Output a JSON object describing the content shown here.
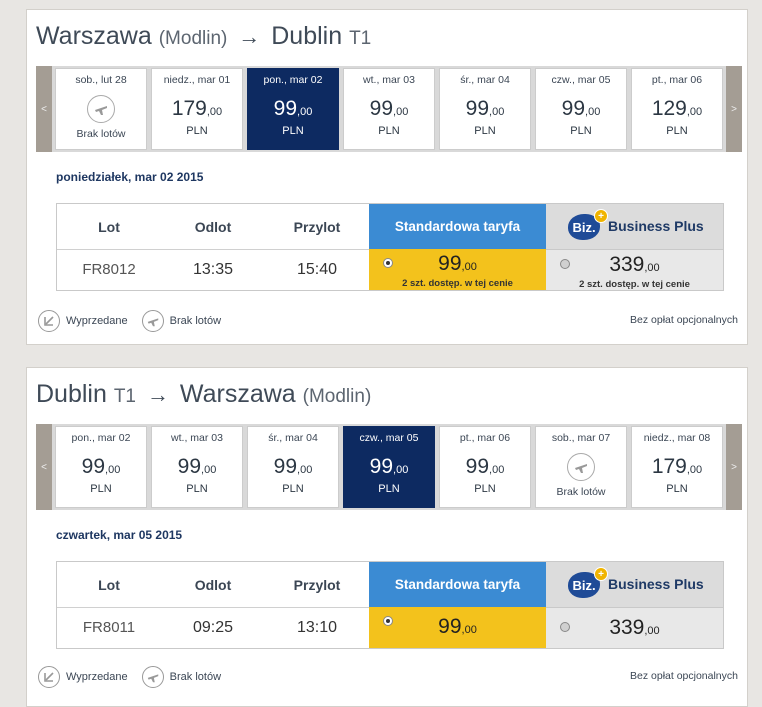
{
  "outbound": {
    "origin": "Warszawa",
    "origin_sub": "(Modlin)",
    "arrow": "→",
    "dest": "Dublin",
    "dest_sub": "T1",
    "nav_prev": "<",
    "nav_next": ">",
    "days": [
      {
        "label": "sob., lut 28",
        "no_flights": true,
        "no_flights_label": "Brak lotów",
        "selected": false
      },
      {
        "label": "niedz., mar 01",
        "price": "179",
        "decimals": ",00",
        "currency": "PLN",
        "selected": false
      },
      {
        "label": "pon., mar 02",
        "price": "99",
        "decimals": ",00",
        "currency": "PLN",
        "selected": true
      },
      {
        "label": "wt., mar 03",
        "price": "99",
        "decimals": ",00",
        "currency": "PLN",
        "selected": false
      },
      {
        "label": "śr., mar 04",
        "price": "99",
        "decimals": ",00",
        "currency": "PLN",
        "selected": false
      },
      {
        "label": "czw., mar 05",
        "price": "99",
        "decimals": ",00",
        "currency": "PLN",
        "selected": false
      },
      {
        "label": "pt., mar 06",
        "price": "129",
        "decimals": ",00",
        "currency": "PLN",
        "selected": false
      }
    ],
    "selected_date": "poniedziałek, mar 02 2015",
    "table": {
      "h_flight": "Lot",
      "h_dep": "Odlot",
      "h_arr": "Przylot",
      "h_std": "Standardowa taryfa",
      "h_biz_logo": "Biz.",
      "h_biz_plus": "+",
      "h_biz": "Business Plus",
      "flight": "FR8012",
      "dep": "13:35",
      "arr": "15:40",
      "std_price": "99",
      "std_dec": ",00",
      "std_avail": "2 szt. dostęp. w tej cenie",
      "biz_price": "339",
      "biz_dec": ",00",
      "biz_avail": "2 szt. dostęp. w tej cenie"
    },
    "legend_sold": "Wyprzedane",
    "legend_none": "Brak lotów",
    "fees": "Bez opłat opcjonalnych"
  },
  "inbound": {
    "origin": "Dublin",
    "origin_sub": "T1",
    "arrow": "→",
    "dest": "Warszawa",
    "dest_sub": "(Modlin)",
    "nav_prev": "<",
    "nav_next": ">",
    "days": [
      {
        "label": "pon., mar 02",
        "price": "99",
        "decimals": ",00",
        "currency": "PLN",
        "selected": false
      },
      {
        "label": "wt., mar 03",
        "price": "99",
        "decimals": ",00",
        "currency": "PLN",
        "selected": false
      },
      {
        "label": "śr., mar 04",
        "price": "99",
        "decimals": ",00",
        "currency": "PLN",
        "selected": false
      },
      {
        "label": "czw., mar 05",
        "price": "99",
        "decimals": ",00",
        "currency": "PLN",
        "selected": true
      },
      {
        "label": "pt., mar 06",
        "price": "99",
        "decimals": ",00",
        "currency": "PLN",
        "selected": false
      },
      {
        "label": "sob., mar 07",
        "no_flights": true,
        "no_flights_label": "Brak lotów",
        "selected": false
      },
      {
        "label": "niedz., mar 08",
        "price": "179",
        "decimals": ",00",
        "currency": "PLN",
        "selected": false
      }
    ],
    "selected_date": "czwartek, mar 05 2015",
    "table": {
      "h_flight": "Lot",
      "h_dep": "Odlot",
      "h_arr": "Przylot",
      "h_std": "Standardowa taryfa",
      "h_biz_logo": "Biz.",
      "h_biz_plus": "+",
      "h_biz": "Business Plus",
      "flight": "FR8011",
      "dep": "09:25",
      "arr": "13:10",
      "std_price": "99",
      "std_dec": ",00",
      "biz_price": "339",
      "biz_dec": ",00"
    },
    "legend_sold": "Wyprzedane",
    "legend_none": "Brak lotów",
    "fees": "Bez opłat opcjonalnych"
  },
  "colors": {
    "selected_day": "#0d2a61",
    "std_header": "#3b8bd3",
    "std_cell": "#f3c21c",
    "biz_logo": "#1f4b97"
  }
}
